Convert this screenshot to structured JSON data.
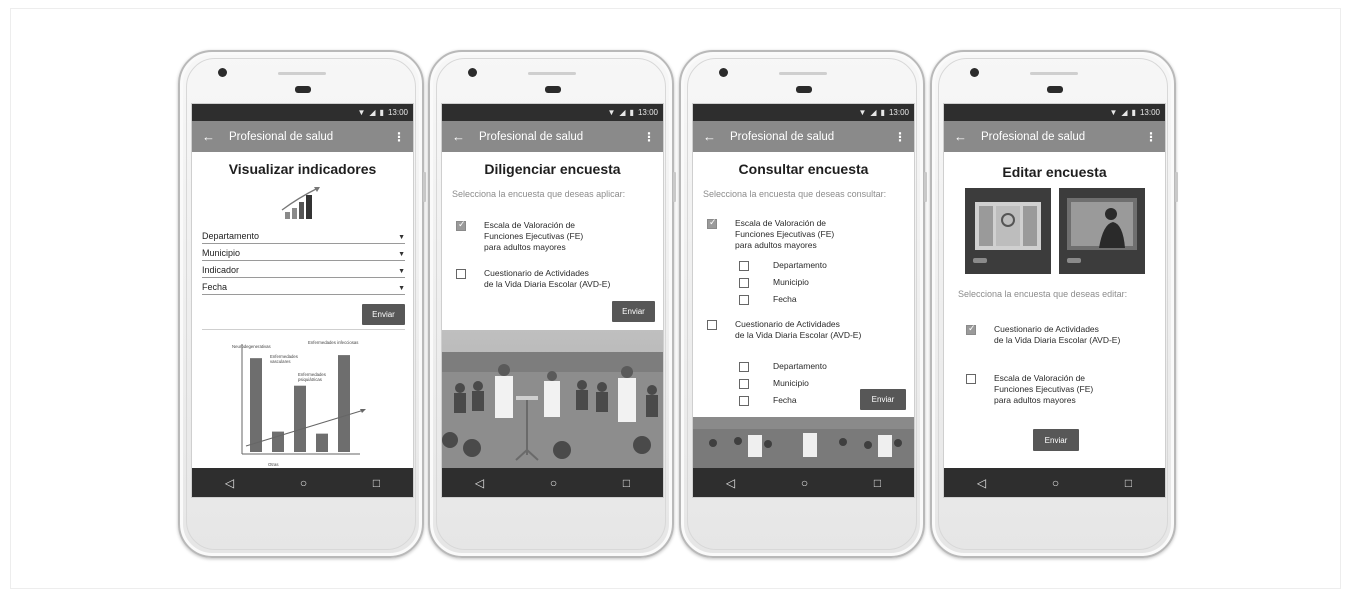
{
  "status_time": "13:00",
  "app_title": "Profesional de salud",
  "nav": {
    "back": "◁",
    "home": "○",
    "recent": "□"
  },
  "screen1": {
    "title": "Visualizar indicadores",
    "dropdowns": [
      "Departamento",
      "Municipio",
      "Indicador",
      "Fecha"
    ],
    "send": "Enviar",
    "chart_data": {
      "type": "bar",
      "categories": [
        "Neurodegenerativas",
        "Otras",
        "Enfermedades vasculares",
        "Enfermedades psiquiátricas",
        "Enfermedades infecciosas"
      ],
      "values": [
        92,
        20,
        65,
        18,
        95
      ],
      "ylim": [
        0,
        100
      ],
      "annotations": [
        "Neurodegenerativas",
        "Enfermedades vasculares",
        "Enfermedades psiquiátricas",
        "Enfermedades infecciosas",
        "Otras"
      ]
    }
  },
  "screen2": {
    "title": "Diligenciar encuesta",
    "prompt": "Selecciona la encuesta que deseas aplicar:",
    "options": [
      {
        "lines": [
          "Escala de Valoración de",
          "Funciones Ejecutivas (FE)",
          "para adultos mayores"
        ],
        "checked": true
      },
      {
        "lines": [
          "Cuestionario de Actividades",
          "de la Vida Diaria Escolar (AVD-E)"
        ],
        "checked": false
      }
    ],
    "send": "Enviar"
  },
  "screen3": {
    "title": "Consultar encuesta",
    "prompt": "Selecciona la encuesta que deseas consultar:",
    "option1": [
      "Escala de Valoración de",
      "Funciones Ejecutivas (FE)",
      "para adultos mayores"
    ],
    "option2": [
      "Cuestionario de Actividades",
      "de la Vida Diaria Escolar (AVD-E)"
    ],
    "suboptions": [
      "Departamento",
      "Municipio",
      "Fecha"
    ],
    "send": "Enviar"
  },
  "screen4": {
    "title": "Editar encuesta",
    "prompt": "Selecciona la encuesta que deseas editar:",
    "options": [
      {
        "lines": [
          "Cuestionario de Actividades",
          "de la Vida Diaria Escolar (AVD-E)"
        ],
        "checked": true
      },
      {
        "lines": [
          "Escala de Valoración de",
          "Funciones Ejecutivas (FE)",
          "para adultos mayores"
        ],
        "checked": false
      }
    ],
    "send": "Enviar"
  }
}
